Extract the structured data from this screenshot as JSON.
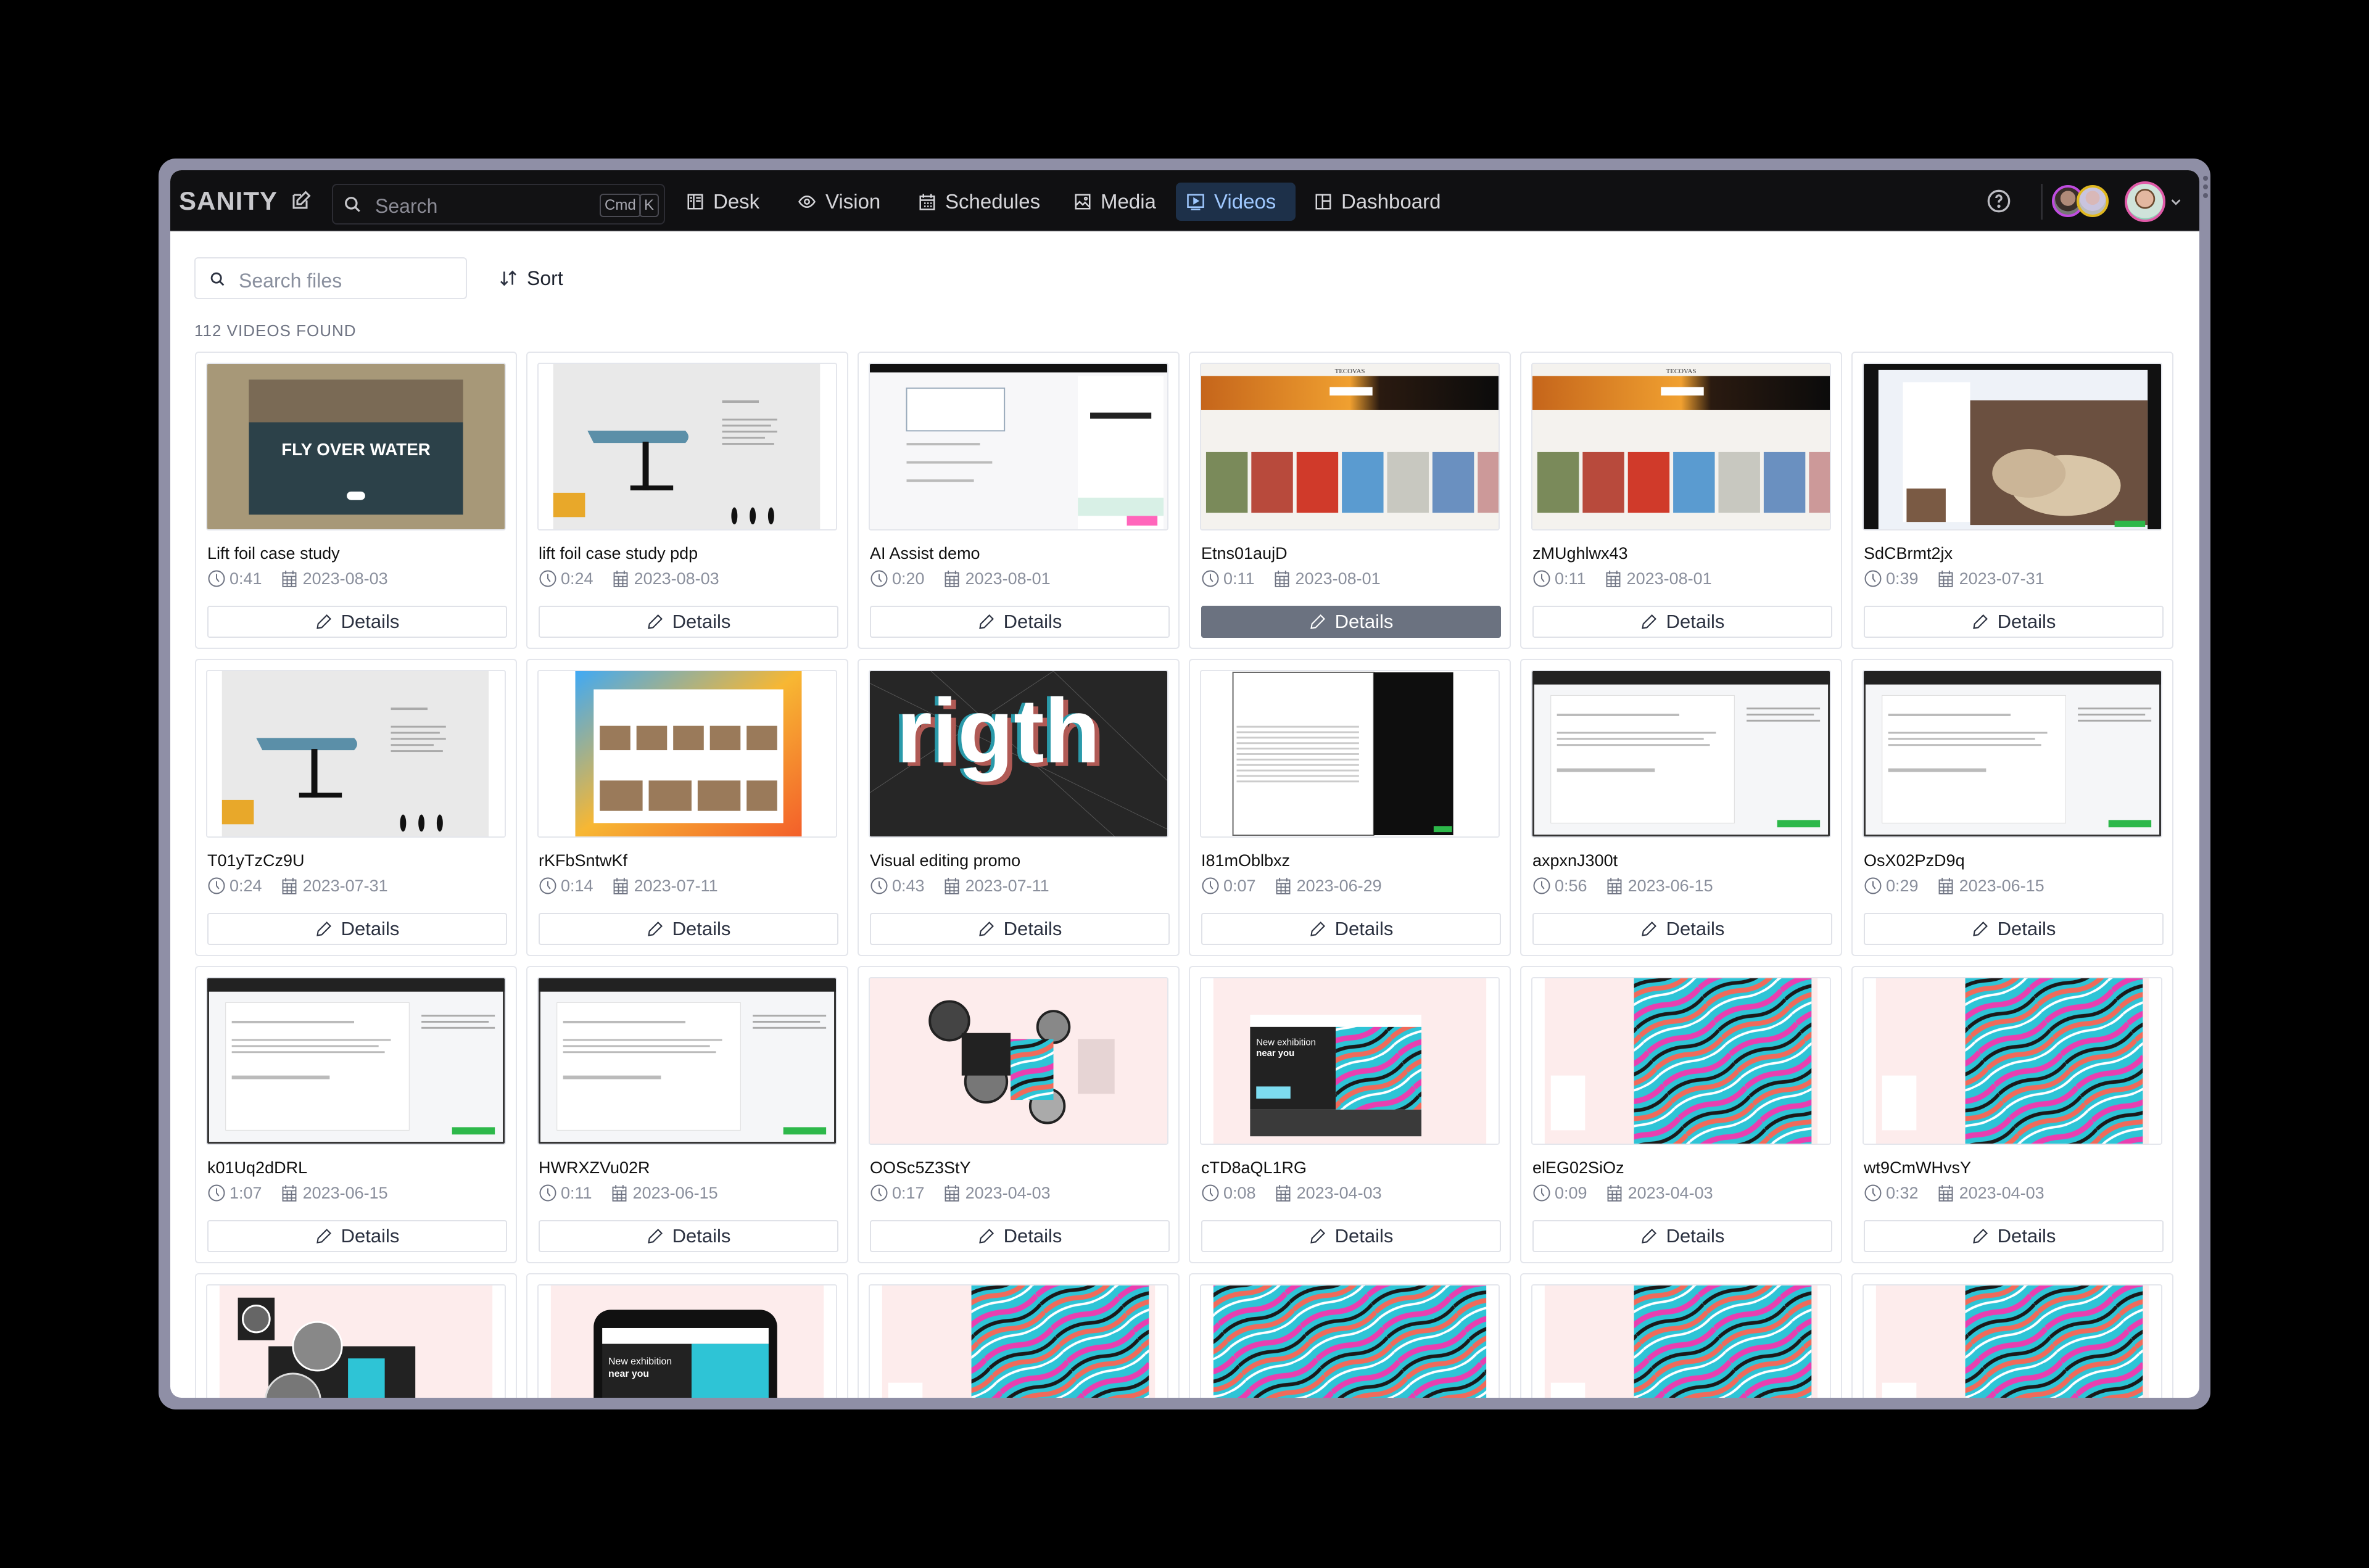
{
  "app": {
    "logo": "SANITY",
    "search_placeholder": "Search",
    "search_shortcut": [
      "Cmd",
      "K"
    ],
    "nav": [
      {
        "label": "Desk",
        "icon": "desk-icon",
        "active": false
      },
      {
        "label": "Vision",
        "icon": "eye-icon",
        "active": false
      },
      {
        "label": "Schedules",
        "icon": "calendar-icon",
        "active": false
      },
      {
        "label": "Media",
        "icon": "image-icon",
        "active": false
      },
      {
        "label": "Videos",
        "icon": "video-icon",
        "active": true
      },
      {
        "label": "Dashboard",
        "icon": "dashboard-icon",
        "active": false
      }
    ],
    "presence_avatar_ring_colors": [
      "#c04ce0",
      "#e0b820"
    ],
    "user_avatar_ring_color": "#e05aa8"
  },
  "toolbar": {
    "search_files_placeholder": "Search files",
    "sort_label": "Sort"
  },
  "results": {
    "count_label": "112 VIDEOS FOUND",
    "details_label": "Details",
    "videos": [
      {
        "title": "Lift foil case study",
        "duration": "0:41",
        "date": "2023-08-03",
        "thumb": "fly"
      },
      {
        "title": "lift foil case study pdp",
        "duration": "0:24",
        "date": "2023-08-03",
        "thumb": "foil"
      },
      {
        "title": "AI Assist demo",
        "duration": "0:20",
        "date": "2023-08-01",
        "thumb": "studio"
      },
      {
        "title": "Etns01aujD",
        "duration": "0:11",
        "date": "2023-08-01",
        "thumb": "tecovas",
        "hover": true
      },
      {
        "title": "zMUghlwx43",
        "duration": "0:11",
        "date": "2023-08-01",
        "thumb": "tecovas"
      },
      {
        "title": "SdCBrmt2jx",
        "duration": "0:39",
        "date": "2023-07-31",
        "thumb": "boot"
      },
      {
        "title": "T01yTzCz9U",
        "duration": "0:24",
        "date": "2023-07-31",
        "thumb": "foil"
      },
      {
        "title": "rKFbSntwKf",
        "duration": "0:14",
        "date": "2023-07-11",
        "thumb": "mac"
      },
      {
        "title": "Visual editing promo",
        "duration": "0:43",
        "date": "2023-07-11",
        "thumb": "rigth"
      },
      {
        "title": "I81mOblbxz",
        "duration": "0:07",
        "date": "2023-06-29",
        "thumb": "table"
      },
      {
        "title": "axpxnJ300t",
        "duration": "0:56",
        "date": "2023-06-15",
        "thumb": "editor"
      },
      {
        "title": "OsX02PzD9q",
        "duration": "0:29",
        "date": "2023-06-15",
        "thumb": "editor"
      },
      {
        "title": "k01Uq2dDRL",
        "duration": "1:07",
        "date": "2023-06-15",
        "thumb": "editor"
      },
      {
        "title": "HWRXZVu02R",
        "duration": "0:11",
        "date": "2023-06-15",
        "thumb": "editor"
      },
      {
        "title": "OOSc5Z3StY",
        "duration": "0:17",
        "date": "2023-04-03",
        "thumb": "faces"
      },
      {
        "title": "cTD8aQL1RG",
        "duration": "0:08",
        "date": "2023-04-03",
        "thumb": "exhibit"
      },
      {
        "title": "elEG02SiOz",
        "duration": "0:09",
        "date": "2023-04-03",
        "thumb": "swirl"
      },
      {
        "title": "wt9CmWHvsY",
        "duration": "0:32",
        "date": "2023-04-03",
        "thumb": "swirl"
      },
      {
        "title": "",
        "duration": "",
        "date": "",
        "thumb": "faces2"
      },
      {
        "title": "",
        "duration": "",
        "date": "",
        "thumb": "phone"
      },
      {
        "title": "",
        "duration": "",
        "date": "",
        "thumb": "swirl"
      },
      {
        "title": "",
        "duration": "",
        "date": "",
        "thumb": "swirlfull"
      },
      {
        "title": "",
        "duration": "",
        "date": "",
        "thumb": "swirl"
      },
      {
        "title": "",
        "duration": "",
        "date": "",
        "thumb": "swirl"
      }
    ]
  }
}
